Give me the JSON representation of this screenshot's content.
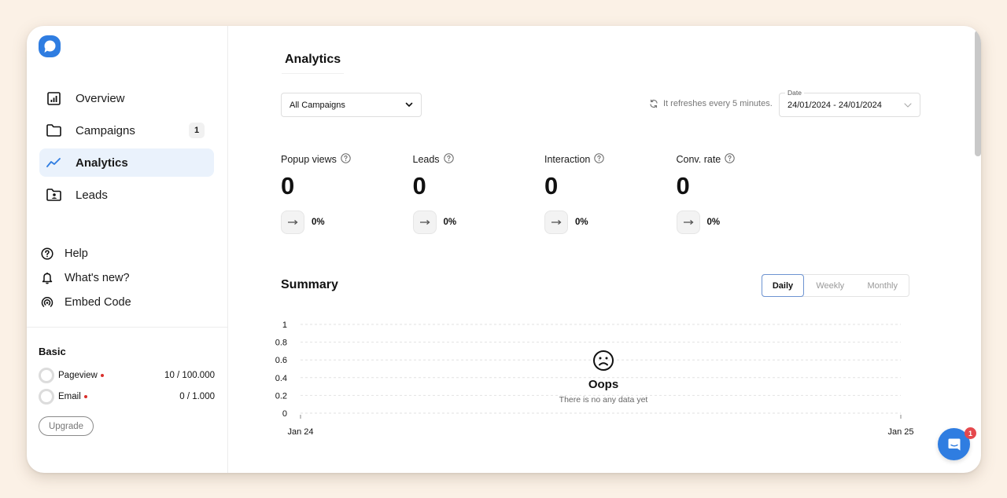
{
  "brand": {
    "accent": "#2f7de1"
  },
  "sidebar": {
    "nav": [
      {
        "label": "Overview",
        "icon": "bar-chart-icon"
      },
      {
        "label": "Campaigns",
        "icon": "folder-icon",
        "badge": "1"
      },
      {
        "label": "Analytics",
        "icon": "trend-line-icon",
        "active": true
      },
      {
        "label": "Leads",
        "icon": "folder-user-icon"
      }
    ],
    "secondary": [
      {
        "label": "Help",
        "icon": "help-circle-icon"
      },
      {
        "label": "What's new?",
        "icon": "bell-icon"
      },
      {
        "label": "Embed Code",
        "icon": "broadcast-icon"
      }
    ],
    "plan": {
      "title": "Basic",
      "usage": [
        {
          "label": "Pageview",
          "value": "10 / 100.000"
        },
        {
          "label": "Email",
          "value": "0 / 1.000"
        }
      ],
      "upgrade_label": "Upgrade"
    }
  },
  "main": {
    "title": "Analytics",
    "campaign_select": {
      "value": "All Campaigns"
    },
    "refresh_text": "It refreshes every 5 minutes.",
    "date": {
      "label": "Date",
      "value": "24/01/2024 - 24/01/2024"
    },
    "stats": [
      {
        "label": "Popup views",
        "value": "0",
        "change": "0%"
      },
      {
        "label": "Leads",
        "value": "0",
        "change": "0%"
      },
      {
        "label": "Interaction",
        "value": "0",
        "change": "0%"
      },
      {
        "label": "Conv. rate",
        "value": "0",
        "change": "0%"
      }
    ],
    "summary": {
      "title": "Summary",
      "periods": [
        {
          "label": "Daily",
          "active": true
        },
        {
          "label": "Weekly"
        },
        {
          "label": "Monthly"
        }
      ],
      "empty_title": "Oops",
      "empty_message": "There is no any data yet"
    }
  },
  "chart_data": {
    "type": "line",
    "title": "",
    "xlabel": "",
    "ylabel": "",
    "x": [
      "Jan 24",
      "Jan 25"
    ],
    "x_tick_labels": [
      "Jan 24",
      "Jan 25"
    ],
    "y_tick_labels": [
      "0",
      "0.2",
      "0.4",
      "0.6",
      "0.8",
      "1"
    ],
    "ylim": [
      0,
      1
    ],
    "grid": true,
    "series": []
  },
  "chat": {
    "unread": "1"
  }
}
